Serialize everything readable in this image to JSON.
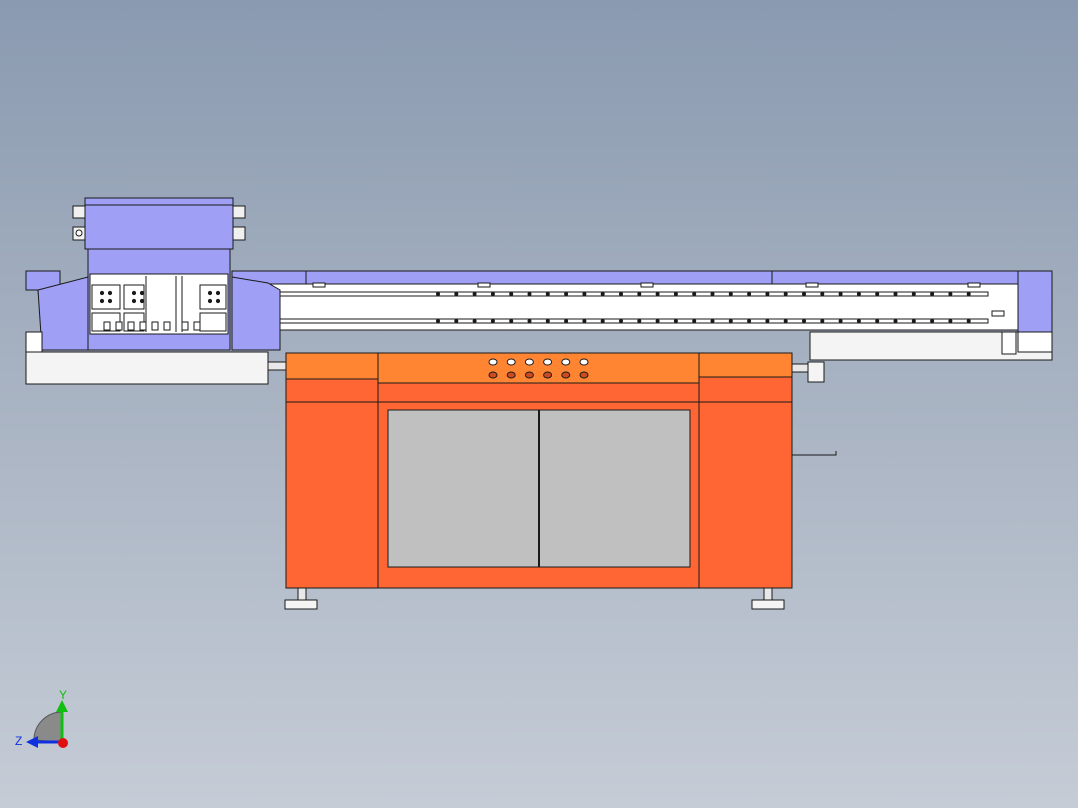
{
  "viewport": {
    "background_top": "#8a9ab0",
    "background_bottom": "#c5ccd6"
  },
  "model": {
    "colors": {
      "gantry": "#9f9ff5",
      "cabinet": "#ff6633",
      "cabinet_top": "#ff8533",
      "door_panel": "#c0c0c0",
      "rail": "#ffffff",
      "outline": "#1a1a1a"
    },
    "control_panel": {
      "button_rows": 2,
      "buttons_per_row": 6
    }
  },
  "triad": {
    "x_color": "#e01010",
    "y_color": "#10c010",
    "z_color": "#1030e0",
    "y_label": "Y",
    "z_label": "Z"
  }
}
